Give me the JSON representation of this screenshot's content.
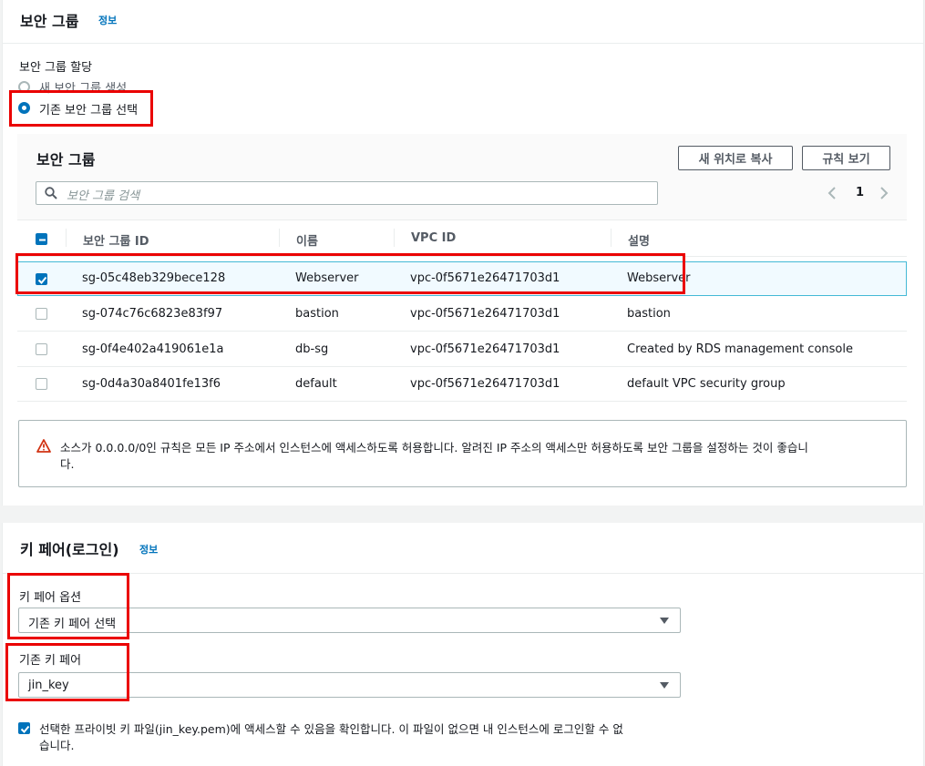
{
  "security_group": {
    "title": "보안 그룹",
    "info": "정보",
    "assign_label": "보안 그룹 할당",
    "option_new": "새 보안 그룹 생성",
    "option_existing": "기존 보안 그룹 선택",
    "selected_option": "existing",
    "table": {
      "title": "보안 그룹",
      "copy_button": "새 위치로 복사",
      "rules_button": "규칙 보기",
      "search_placeholder": "보안 그룹 검색",
      "page": "1",
      "columns": [
        "보안 그룹 ID",
        "이름",
        "VPC ID",
        "설명"
      ],
      "rows": [
        {
          "id": "sg-05c48eb329bece128",
          "name": "Webserver",
          "vpc": "vpc-0f5671e26471703d1",
          "desc": "Webserver",
          "checked": true
        },
        {
          "id": "sg-074c76c6823e83f97",
          "name": "bastion",
          "vpc": "vpc-0f5671e26471703d1",
          "desc": "bastion",
          "checked": false
        },
        {
          "id": "sg-0f4e402a419061e1a",
          "name": "db-sg",
          "vpc": "vpc-0f5671e26471703d1",
          "desc": "Created by RDS management console",
          "checked": false
        },
        {
          "id": "sg-0d4a30a8401fe13f6",
          "name": "default",
          "vpc": "vpc-0f5671e26471703d1",
          "desc": "default VPC security group",
          "checked": false
        }
      ]
    },
    "warning_line1": "소스가 0.0.0.0/0인 규칙은 모든 IP 주소에서 인스턴스에 액세스하도록 허용합니다. 알려진 IP 주소의 액세스만 허용하도록 보안 그룹을 설정하는 것이 좋습니",
    "warning_line2": "다."
  },
  "key_pair": {
    "title": "키 페어(로그인)",
    "info": "정보",
    "option_label": "키 페어 옵션",
    "option_value": "기존 키 페어 선택",
    "existing_label": "기존 키 페어",
    "existing_value": "jin_key",
    "ack_line1": "선택한 프라이빗 키 파일(jin_key.pem)에 액세스할 수 있음을 확인합니다. 이 파일이 없으면 내 인스턴스에 로그인할 수 없",
    "ack_line2": "습니다.",
    "ack_checked": true
  },
  "colors": {
    "accent": "#0073bb",
    "highlight": "#ea0000",
    "warning": "#d13212"
  }
}
